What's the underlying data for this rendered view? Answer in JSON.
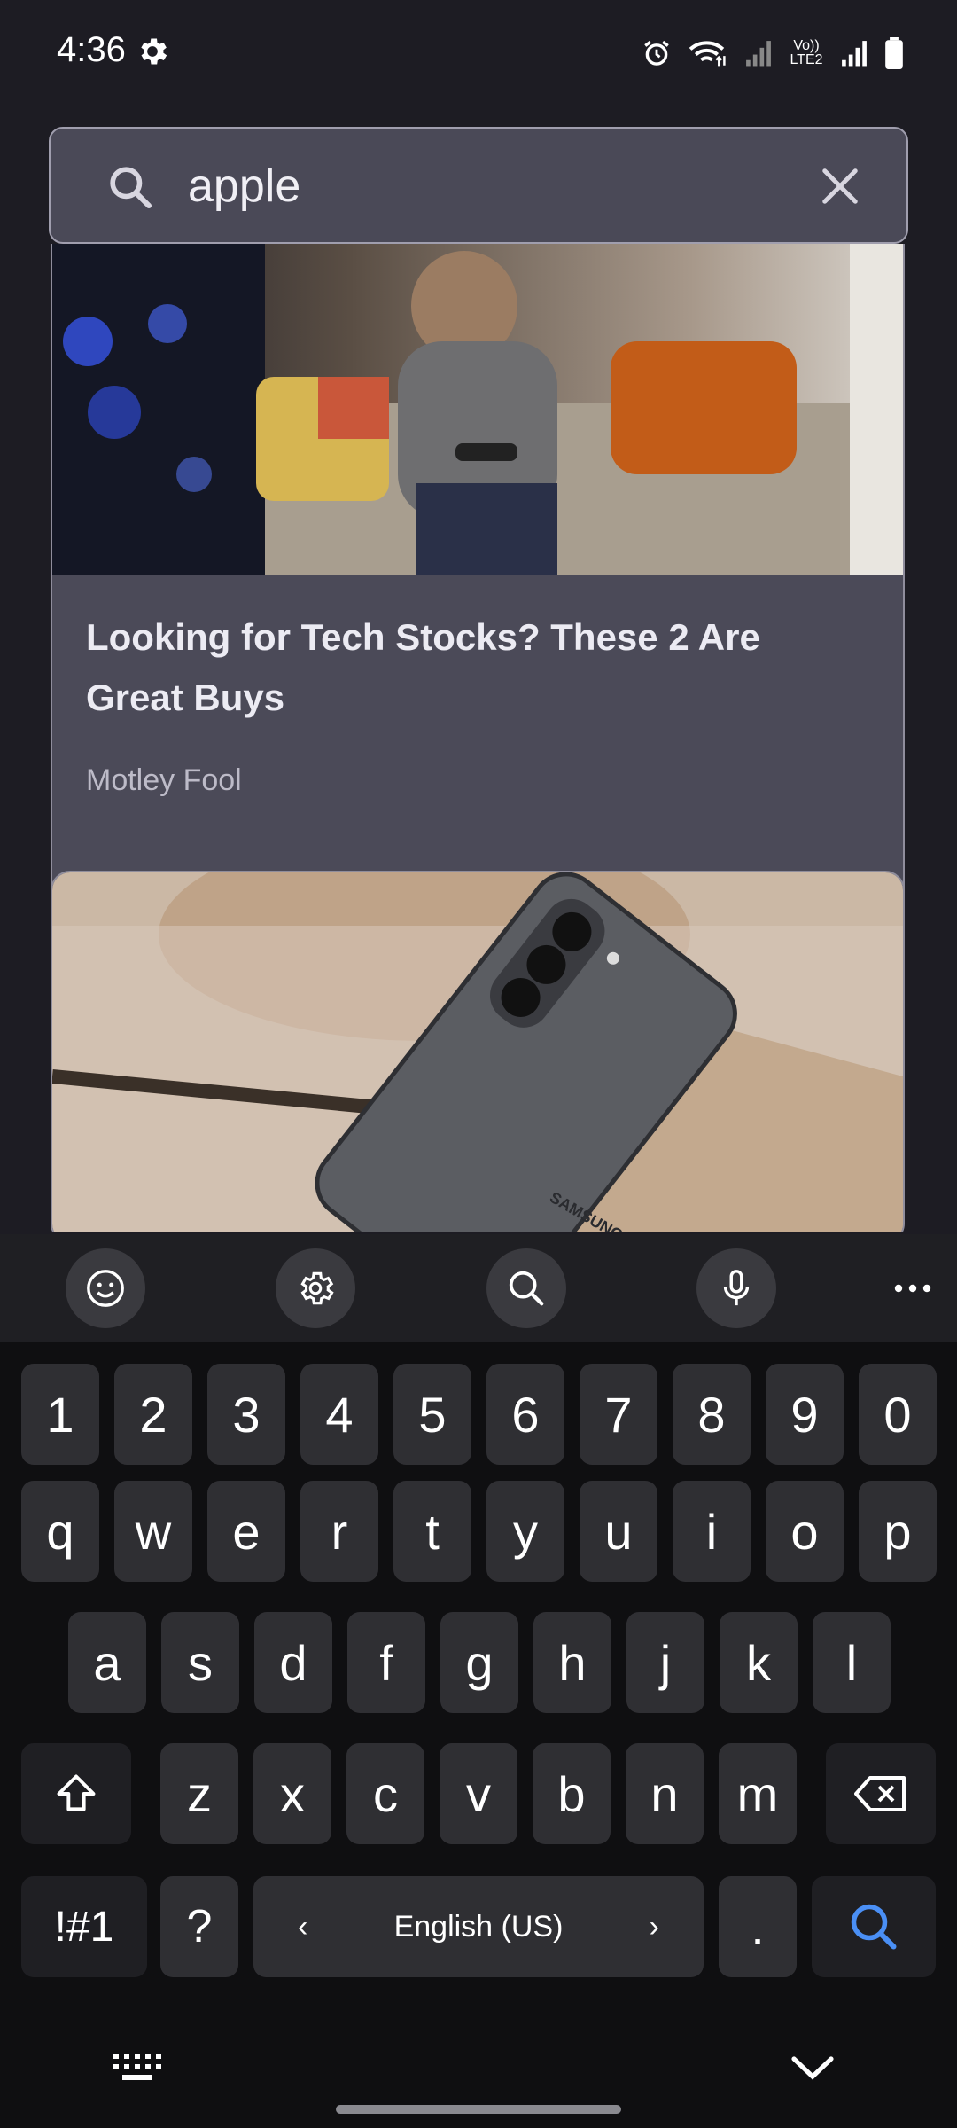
{
  "status": {
    "time": "4:36",
    "network_label": "Vo)) LTE2"
  },
  "search": {
    "query": "apple",
    "placeholder": ""
  },
  "articles": [
    {
      "title": "Looking for Tech Stocks? These 2 Are Great Buys",
      "source": "Motley Fool"
    },
    {
      "title": "",
      "source": "",
      "photo_brand_text": "SAMSUNG"
    }
  ],
  "keyboard": {
    "toolbar": [
      "emoji-icon",
      "settings-icon",
      "search-icon",
      "microphone-icon",
      "more-icon"
    ],
    "number_row": [
      "1",
      "2",
      "3",
      "4",
      "5",
      "6",
      "7",
      "8",
      "9",
      "0"
    ],
    "row1": [
      "q",
      "w",
      "e",
      "r",
      "t",
      "y",
      "u",
      "i",
      "o",
      "p"
    ],
    "row2": [
      "a",
      "s",
      "d",
      "f",
      "g",
      "h",
      "j",
      "k",
      "l"
    ],
    "row3": [
      "z",
      "x",
      "c",
      "v",
      "b",
      "n",
      "m"
    ],
    "symbols_label": "!#1",
    "question_label": "?",
    "language_label": "English (US)",
    "period_label": ".",
    "accent": "#4a8ff5"
  }
}
